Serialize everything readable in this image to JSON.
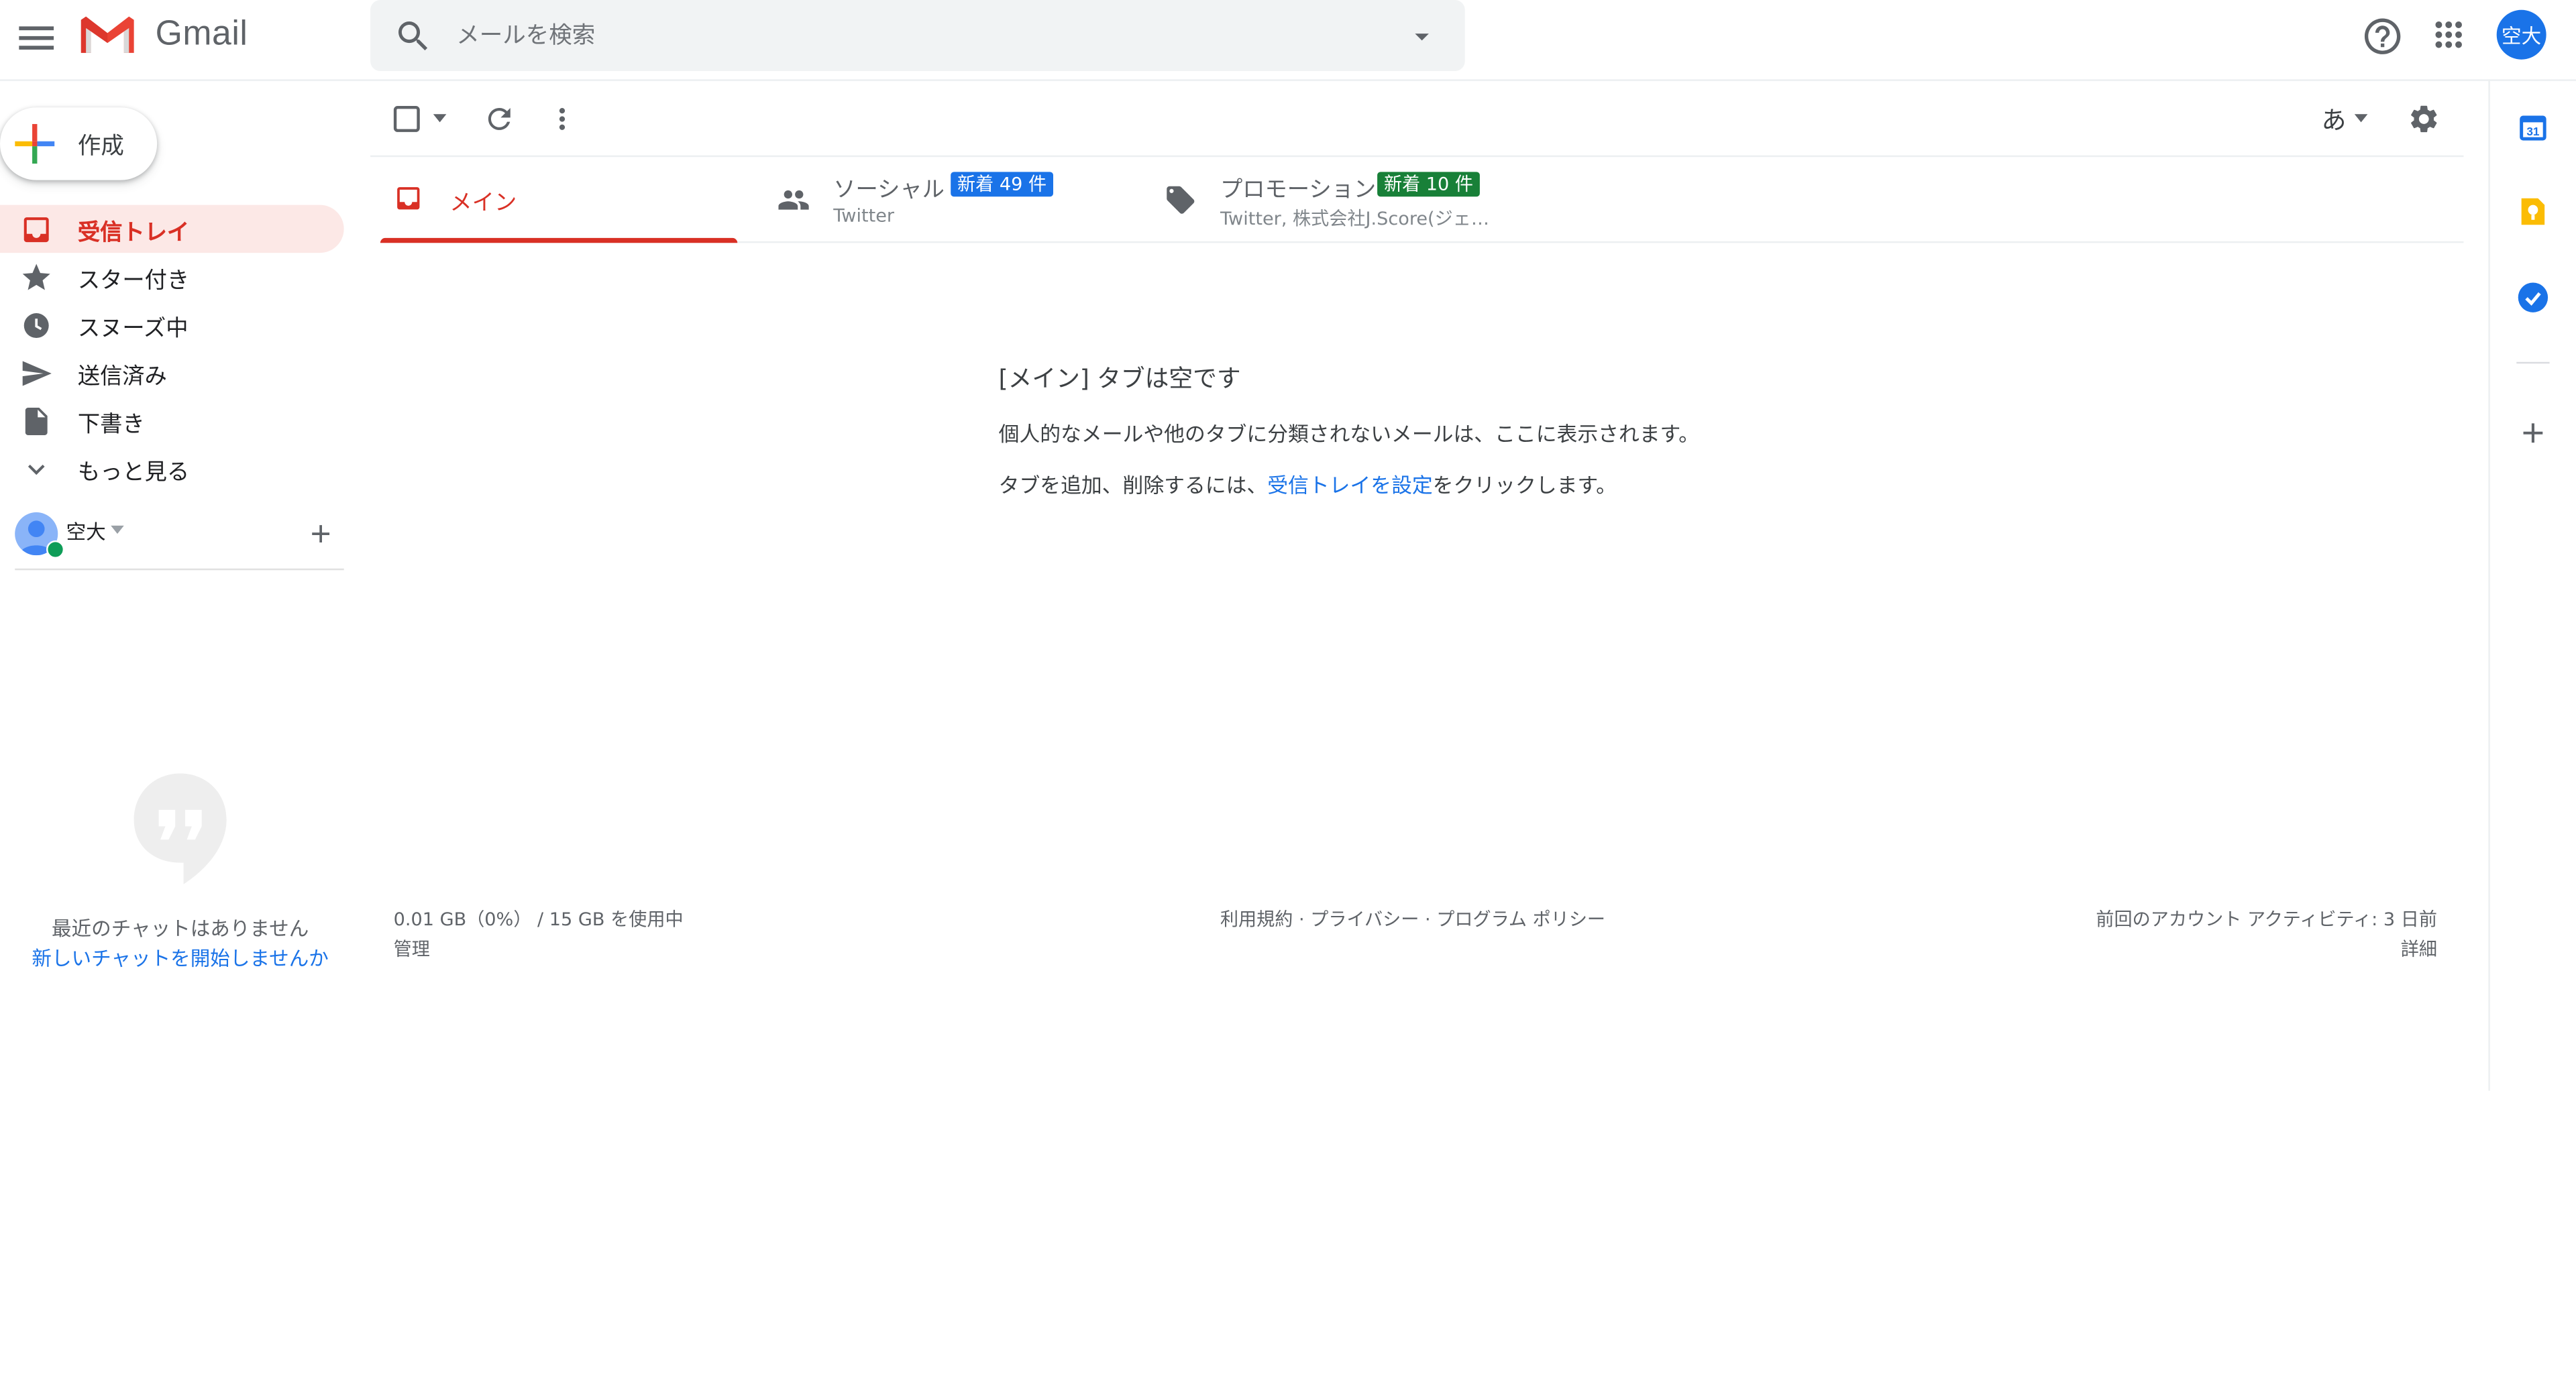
{
  "header": {
    "app_name": "Gmail",
    "search_placeholder": "メールを検索",
    "avatar_text": "空大"
  },
  "compose": {
    "label": "作成"
  },
  "nav": {
    "items": [
      {
        "label": "受信トレイ",
        "icon": "inbox-icon",
        "active": true
      },
      {
        "label": "スター付き",
        "icon": "star-icon"
      },
      {
        "label": "スヌーズ中",
        "icon": "clock-icon"
      },
      {
        "label": "送信済み",
        "icon": "send-icon"
      },
      {
        "label": "下書き",
        "icon": "draft-icon"
      },
      {
        "label": "もっと見る",
        "icon": "chevron-down-icon"
      }
    ]
  },
  "hangouts": {
    "user_name": "空大",
    "empty_text": "最近のチャットはありません",
    "start_link": "新しいチャットを開始しませんか"
  },
  "toolbar": {
    "input_tool_label": "あ"
  },
  "tabs": {
    "main": {
      "label": "メイン"
    },
    "social": {
      "label": "ソーシャル",
      "badge": "新着 49 件",
      "senders": "Twitter"
    },
    "promotions": {
      "label": "プロモーション",
      "badge": "新着 10 件",
      "senders": "Twitter, 株式会社J.Score(ジェ…"
    }
  },
  "empty_state": {
    "title": "[メイン] タブは空です",
    "description": "個人的なメールや他のタブに分類されないメールは、ここに表示されます。",
    "hint_prefix": "タブを追加、削除するには、",
    "hint_link": "受信トレイを設定",
    "hint_suffix": "をクリックします。"
  },
  "footer": {
    "storage": "0.01 GB（0%） / 15 GB を使用中",
    "manage": "管理",
    "links": "利用規約 · プライバシー · プログラム ポリシー",
    "activity": "前回のアカウント アクティビティ: 3 日前",
    "details": "詳細"
  },
  "colors": {
    "accent_red": "#d93025",
    "active_bg": "#fce8e6",
    "link_blue": "#1a73e8",
    "social_badge": "#1a73e8",
    "promo_badge": "#188038"
  }
}
